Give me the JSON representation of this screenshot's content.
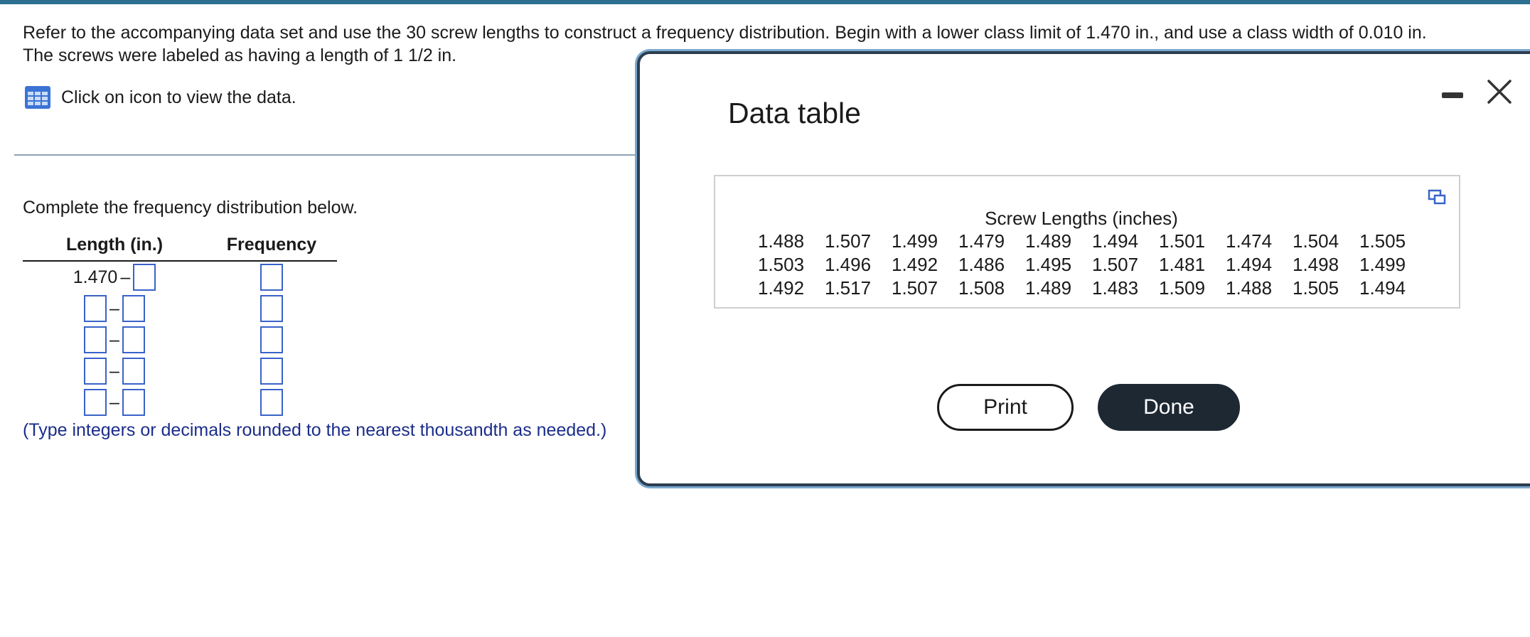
{
  "question": {
    "line1": "Refer to the accompanying data set and use the 30 screw lengths to construct a frequency distribution. Begin with a lower class limit of 1.470 in., and use a class width of 0.010 in.",
    "line2": "The screws were labeled as having a length of 1 1/2 in."
  },
  "data_link": {
    "label": "Click on icon to view the data.",
    "icon": "table-grid-icon"
  },
  "instruction": "Complete the frequency distribution below.",
  "freq_table": {
    "header_length": "Length (in.)",
    "header_frequency": "Frequency",
    "first_lower": "1.470",
    "dash": "–"
  },
  "note": "(Type integers or decimals rounded to the nearest thousandth as needed.)",
  "modal": {
    "title": "Data table",
    "caption": "Screw Lengths (inches)",
    "rows": [
      [
        "1.488",
        "1.507",
        "1.499",
        "1.479",
        "1.489",
        "1.494",
        "1.501",
        "1.474",
        "1.504",
        "1.505"
      ],
      [
        "1.503",
        "1.496",
        "1.492",
        "1.486",
        "1.495",
        "1.507",
        "1.481",
        "1.494",
        "1.498",
        "1.499"
      ],
      [
        "1.492",
        "1.517",
        "1.507",
        "1.508",
        "1.489",
        "1.483",
        "1.509",
        "1.488",
        "1.505",
        "1.494"
      ]
    ],
    "print_label": "Print",
    "done_label": "Done"
  },
  "colors": {
    "accent_bar": "#2c6f91",
    "input_border": "#3a62c8",
    "note_text": "#1b2d8a",
    "done_button": "#1e2833"
  }
}
